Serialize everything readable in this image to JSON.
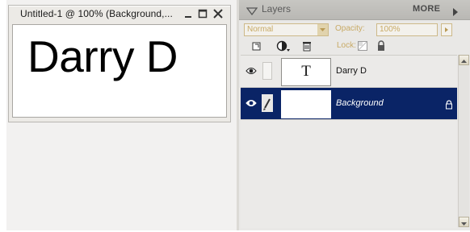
{
  "document": {
    "title": "Untitled-1 @ 100% (Background,...",
    "canvas_text": "Darry D"
  },
  "layers_panel": {
    "title": "Layers",
    "more_label": "MORE",
    "blend_mode": "Normal",
    "opacity_label": "Opacity:",
    "opacity_value": "100%",
    "lock_label": "Lock:",
    "layers": [
      {
        "name": "Darry D",
        "thumb_label": "T",
        "selected": false
      },
      {
        "name": "Background",
        "selected": true
      }
    ]
  },
  "icons": {
    "minimize": "minimize-icon",
    "maximize": "maximize-icon",
    "close": "close-icon",
    "collapse": "collapse-triangle-icon",
    "more": "more-arrow-icon",
    "new_layer": "new-layer-icon",
    "adjustment": "adjustment-layer-icon",
    "delete": "trash-icon",
    "lock_transparent": "lock-transparent-icon",
    "lock_all": "lock-icon",
    "visibility": "eye-icon",
    "brush": "brush-icon"
  },
  "colors": {
    "selected_row": "#0a2466",
    "disabled_text": "#c8aa65",
    "panel_header": "#c0bfbb"
  }
}
